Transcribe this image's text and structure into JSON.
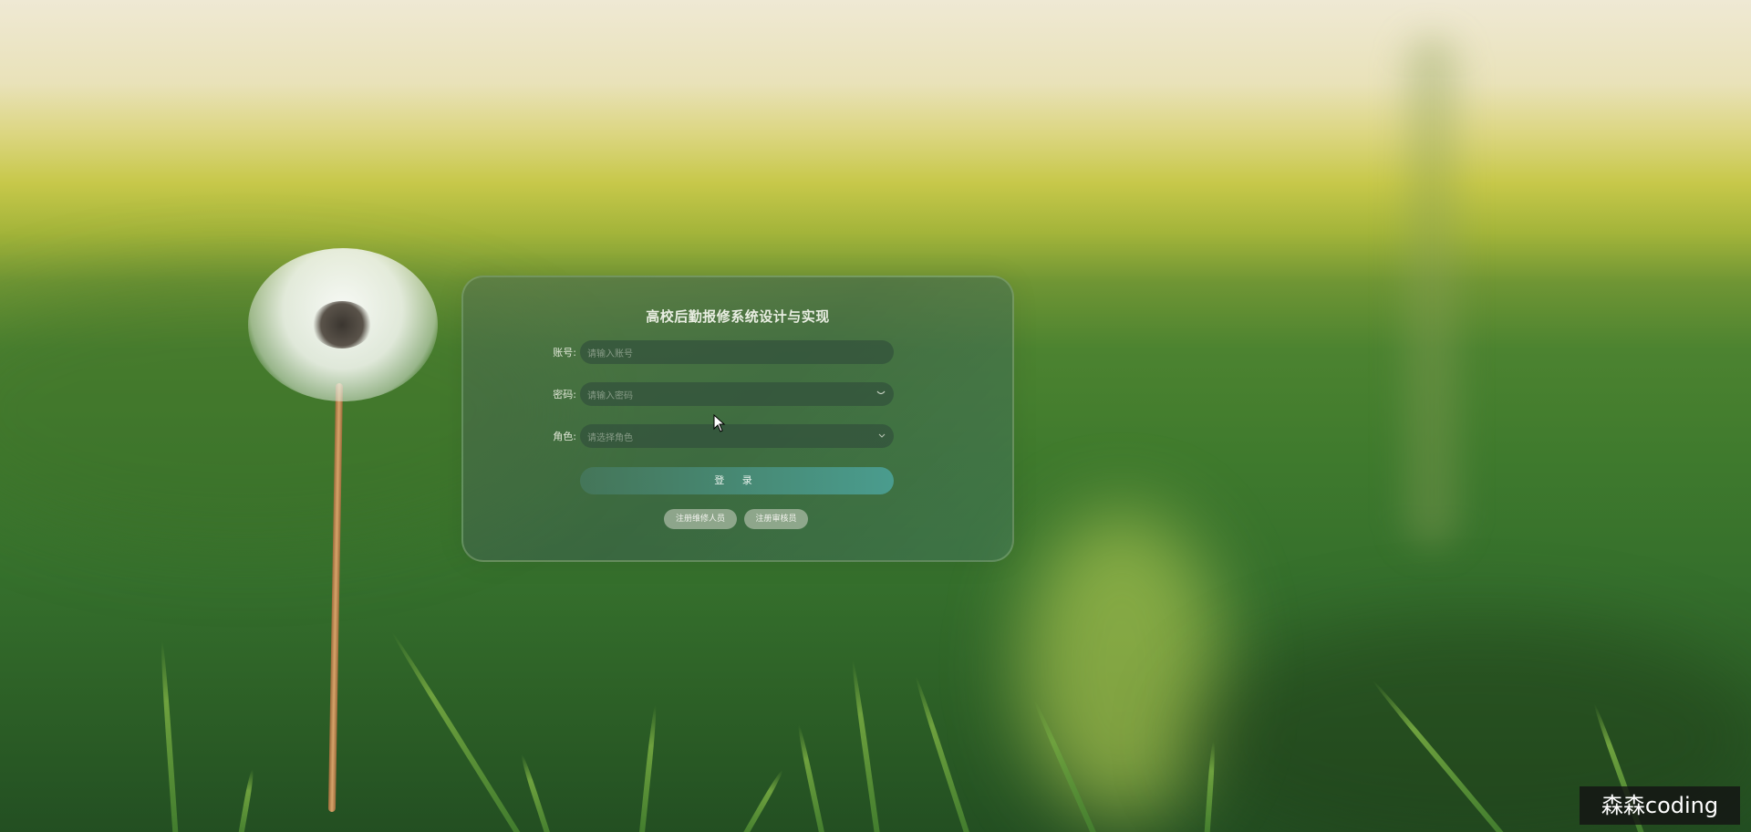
{
  "login": {
    "title": "高校后勤报修系统设计与实现",
    "fields": {
      "account": {
        "label": "账号:",
        "placeholder": "请输入账号"
      },
      "password": {
        "label": "密码:",
        "placeholder": "请输入密码",
        "icon": "eye-closed-icon"
      },
      "role": {
        "label": "角色:",
        "placeholder": "请选择角色",
        "icon": "chevron-down-icon"
      }
    },
    "submit_label": "登 录",
    "links": {
      "register_repair": "注册维修人员",
      "register_audit": "注册审核员"
    }
  },
  "watermark": "森森coding",
  "colors": {
    "card_bg": "#3f6a55",
    "button_accent": "#4a9c8e",
    "text_light": "#e9eee2"
  }
}
